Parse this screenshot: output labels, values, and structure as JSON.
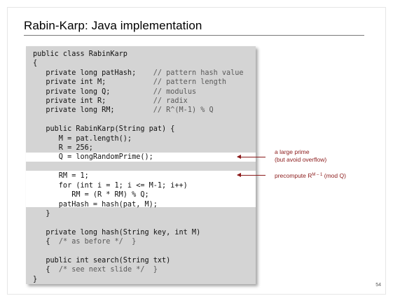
{
  "slide": {
    "title": "Rabin-Karp:  Java implementation",
    "page_number": "54"
  },
  "code_lines": [
    {
      "code": "public class RabinKarp",
      "comment": ""
    },
    {
      "code": "{",
      "comment": ""
    },
    {
      "code": "   private long patHash;    ",
      "comment": "// pattern hash value"
    },
    {
      "code": "   private int M;           ",
      "comment": "// pattern length"
    },
    {
      "code": "   private long Q;          ",
      "comment": "// modulus"
    },
    {
      "code": "   private int R;           ",
      "comment": "// radix"
    },
    {
      "code": "   private long RM;         ",
      "comment": "// R^(M-1) % Q"
    },
    {
      "code": "",
      "comment": ""
    },
    {
      "code": "   public RabinKarp(String pat) {",
      "comment": ""
    },
    {
      "code": "      M = pat.length();",
      "comment": ""
    },
    {
      "code": "      R = 256;",
      "comment": ""
    },
    {
      "code": "      Q = longRandomPrime();",
      "comment": ""
    },
    {
      "code": "",
      "comment": ""
    },
    {
      "code": "      RM = 1;",
      "comment": ""
    },
    {
      "code": "      for (int i = 1; i <= M-1; i++)",
      "comment": ""
    },
    {
      "code": "         RM = (R * RM) % Q;",
      "comment": ""
    },
    {
      "code": "      patHash = hash(pat, M);",
      "comment": ""
    },
    {
      "code": "   }",
      "comment": ""
    },
    {
      "code": "",
      "comment": ""
    },
    {
      "code": "   private long hash(String key, int M)",
      "comment": ""
    },
    {
      "code": "   {  ",
      "comment": "/* as before */  }"
    },
    {
      "code": "",
      "comment": ""
    },
    {
      "code": "   public int search(String txt)",
      "comment": ""
    },
    {
      "code": "   {  ",
      "comment": "/* see next slide */  }"
    },
    {
      "code": "}",
      "comment": ""
    }
  ],
  "annotations": {
    "prime_note_line1": "a large prime",
    "prime_note_line2": "(but avoid overflow)",
    "precompute_prefix": "precompute R",
    "precompute_sup": "M – 1",
    "precompute_suffix": " (mod Q)"
  },
  "colors": {
    "annotation": "#8b1a1a",
    "code_background": "#d4d4d4"
  }
}
